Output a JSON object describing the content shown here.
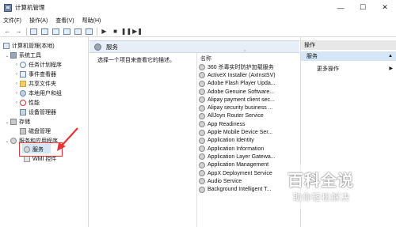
{
  "window": {
    "title": "计算机管理",
    "controls": {
      "minimize": "—",
      "maximize": "☐",
      "close": "✕"
    }
  },
  "menu": [
    "文件(F)",
    "操作(A)",
    "查看(V)",
    "帮助(H)"
  ],
  "toolbar": {
    "back": "←",
    "forward": "→",
    "play": "▶",
    "stop": "■",
    "pause": "❚❚",
    "restart": "▶❚"
  },
  "tree": {
    "root": "计算机管理(本地)",
    "system_tools": "系统工具",
    "task_scheduler": "任务计划程序",
    "event_viewer": "事件查看器",
    "shared_folders": "共享文件夹",
    "local_users": "本地用户和组",
    "performance": "性能",
    "device_manager": "设备管理器",
    "storage": "存储",
    "disk_management": "磁盘管理",
    "services_apps": "服务和应用程序",
    "services": "服务",
    "wmi": "WMI 控件"
  },
  "center": {
    "header": "服务",
    "description": "选择一个项目来查看它的描述。",
    "column_name": "名称",
    "services": [
      "360 杀毒实时防护加载服务",
      "ActiveX Installer (AxInstSV)",
      "Adobe Flash Player Upda...",
      "Adobe Genuine Software...",
      "Alipay payment client sec...",
      "Alipay security business ...",
      "AllJoyn Router Service",
      "App Readiness",
      "Apple Mobile Device Ser...",
      "Application Identity",
      "Application Information",
      "Application Layer Gatewa...",
      "Application Management",
      "AppX Deployment Service",
      "Audio Service",
      "Background Intelligent T..."
    ]
  },
  "actions": {
    "title": "操作",
    "section": "服务",
    "more": "更多操作"
  },
  "watermark": {
    "main": "百科全说",
    "sub": "助你轻松解决"
  },
  "colors": {
    "selection": "#d5e6f7",
    "header_bg": "#e7eef7",
    "annotation_red": "#e53535"
  }
}
